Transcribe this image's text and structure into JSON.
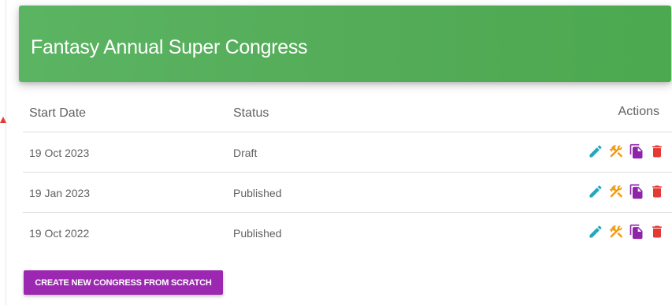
{
  "header": {
    "title": "Fantasy Annual Super Congress"
  },
  "table": {
    "columns": {
      "start_date": "Start Date",
      "status": "Status",
      "actions": "Actions"
    },
    "rows": [
      {
        "start_date": "19 Oct 2023",
        "status": "Draft"
      },
      {
        "start_date": "19 Jan 2023",
        "status": "Published"
      },
      {
        "start_date": "19 Oct 2022",
        "status": "Published"
      }
    ]
  },
  "actions_icons": [
    "edit-pencil-icon",
    "tools-icon",
    "copy-icon",
    "delete-icon"
  ],
  "colors": {
    "header_green": "#53ab57",
    "edit": "#26a6bd",
    "tools": "#f39c12",
    "copy": "#8e24aa",
    "delete": "#e53935",
    "button_purple": "#9c27b0"
  },
  "buttons": {
    "create": "CREATE NEW CONGRESS FROM SCRATCH"
  }
}
